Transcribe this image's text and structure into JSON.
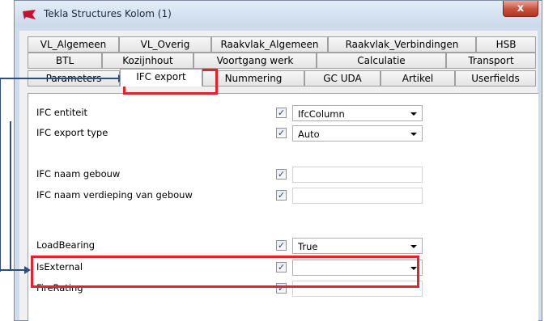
{
  "window": {
    "title": "Tekla Structures  Kolom (1)",
    "close_label": "x"
  },
  "tabs": {
    "row1": [
      "VL_Algemeen",
      "VL_Overig",
      "Raakvlak_Algemeen",
      "Raakvlak_Verbindingen",
      "HSB"
    ],
    "row2": [
      "BTL",
      "Kozijnhout",
      "Voortgang werk",
      "Calculatie",
      "Transport"
    ],
    "row3": [
      "Parameters",
      "IFC export",
      "Nummering",
      "GC UDA",
      "Artikel",
      "Userfields"
    ],
    "active": "IFC export"
  },
  "fields": [
    {
      "label": "IFC entiteit",
      "checked": true,
      "type": "combo",
      "value": "IfcColumn"
    },
    {
      "label": "IFC export type",
      "checked": true,
      "type": "combo",
      "value": "Auto"
    },
    {
      "label": "IFC naam gebouw",
      "checked": true,
      "type": "text",
      "value": ""
    },
    {
      "label": "IFC naam verdieping van gebouw",
      "checked": true,
      "type": "text",
      "value": ""
    },
    {
      "label": "LoadBearing",
      "checked": true,
      "type": "combo",
      "value": "True"
    },
    {
      "label": "IsExternal",
      "checked": true,
      "type": "combo",
      "value": ""
    },
    {
      "label": "FireRating",
      "checked": true,
      "type": "text",
      "value": ""
    }
  ],
  "colors": {
    "highlight": "#e4222e",
    "annotation_line": "#2e4e7e",
    "app_icon": "#c8102e"
  }
}
